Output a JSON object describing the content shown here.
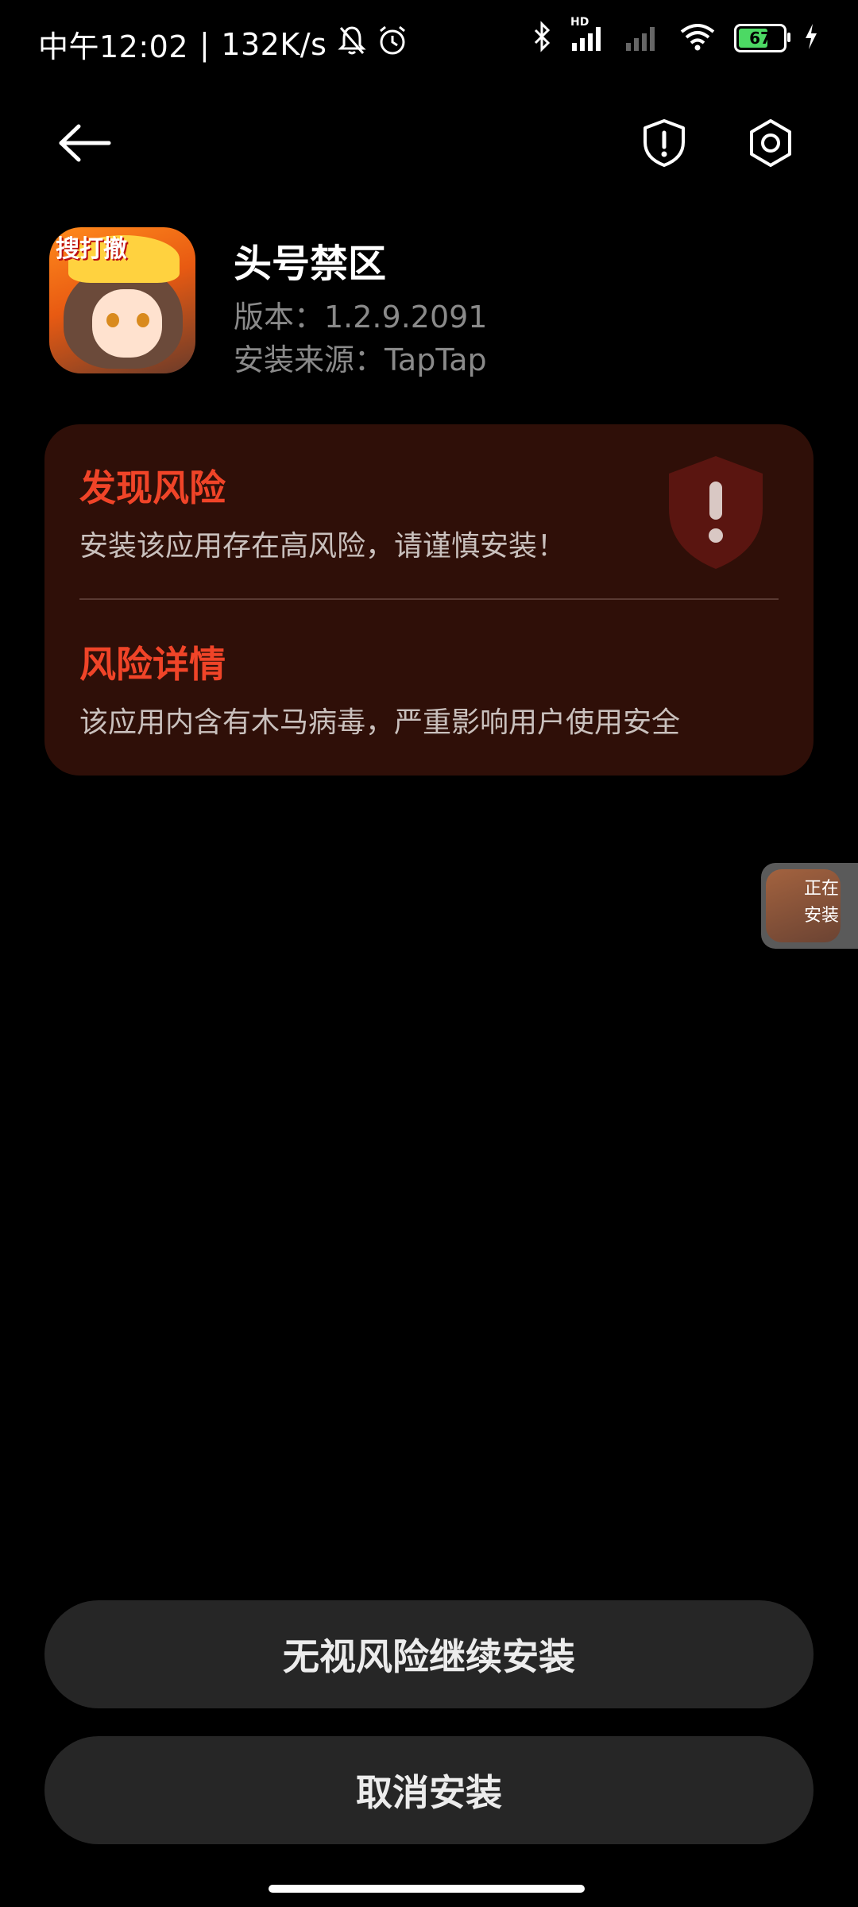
{
  "status_bar": {
    "time": "中午12:02",
    "separator": "|",
    "net_speed": "132K/s",
    "icons": [
      "mute-bell-icon",
      "alarm-icon",
      "bluetooth-icon",
      "signal-hd-icon",
      "signal-icon",
      "wifi-icon",
      "battery-icon",
      "charging-icon"
    ],
    "hd_label": "HD",
    "battery_level": "67"
  },
  "toolbar": {
    "back_icon": "back-arrow-icon",
    "shield_icon": "shield-icon",
    "settings_icon": "gear-icon"
  },
  "app": {
    "name": "头号禁区",
    "version": "版本：1.2.9.2091",
    "source": "安装来源：TapTap",
    "icon_logo": "搜打撤"
  },
  "risk": {
    "title": "发现风险",
    "desc": "安装该应用存在高风险，请谨慎安装！",
    "detail_title": "风险详情",
    "detail_desc": "该应用内含有木马病毒，严重影响用户使用安全",
    "accent_color": "#f04428",
    "card_color": "#2f0f08"
  },
  "floating_bubble": {
    "line1": "正在",
    "line2": "安装"
  },
  "buttons": {
    "continue": "无视风险继续安装",
    "cancel": "取消安装"
  }
}
